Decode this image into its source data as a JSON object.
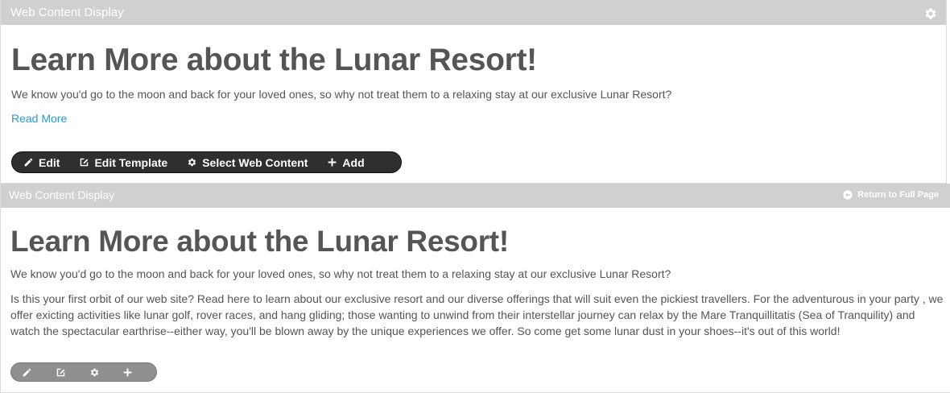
{
  "portlet1": {
    "title": "Web Content Display",
    "config_icon": "gear-icon",
    "heading": "Learn More about the Lunar Resort!",
    "lead": "We know you'd go to the moon and back for your loved ones, so why not treat them to a relaxing stay at our exclusive Lunar Resort?",
    "read_more": "Read More",
    "toolbar": {
      "edit": "Edit",
      "edit_template": "Edit Template",
      "select_web_content": "Select Web Content",
      "add": "Add"
    }
  },
  "portlet2": {
    "title": "Web Content Display",
    "return_link": "Return to Full Page",
    "heading": "Learn More about the Lunar Resort!",
    "lead": "We know you'd go to the moon and back for your loved ones, so why not treat them to a relaxing stay at our exclusive Lunar Resort?",
    "body": "Is this your first orbit of our web site? Read here to learn about our exclusive resort and our diverse offerings that will suit even the pickiest travellers. For the adventurous in your party , we offer exicting activities like lunar golf, rover races, and hang gliding; those wanting to unwind from their interstellar journey can relax by the Mare Tranquillitatis (Sea of Tranquility) and watch the spectacular earthrise--either way, you'll be blown away by the unique experiences we offer.  So come get some lunar dust in your shoes--it's out of this world!",
    "toolbar_icons": [
      "pencil-icon",
      "edit-template-icon",
      "gear-icon",
      "plus-icon"
    ]
  },
  "colors": {
    "titlebar": "#d0d0d0",
    "link": "#1a9ee0",
    "text": "#555555",
    "toolbar_dark": "#2f2f2f",
    "toolbar_light": "#8f8f8f"
  }
}
